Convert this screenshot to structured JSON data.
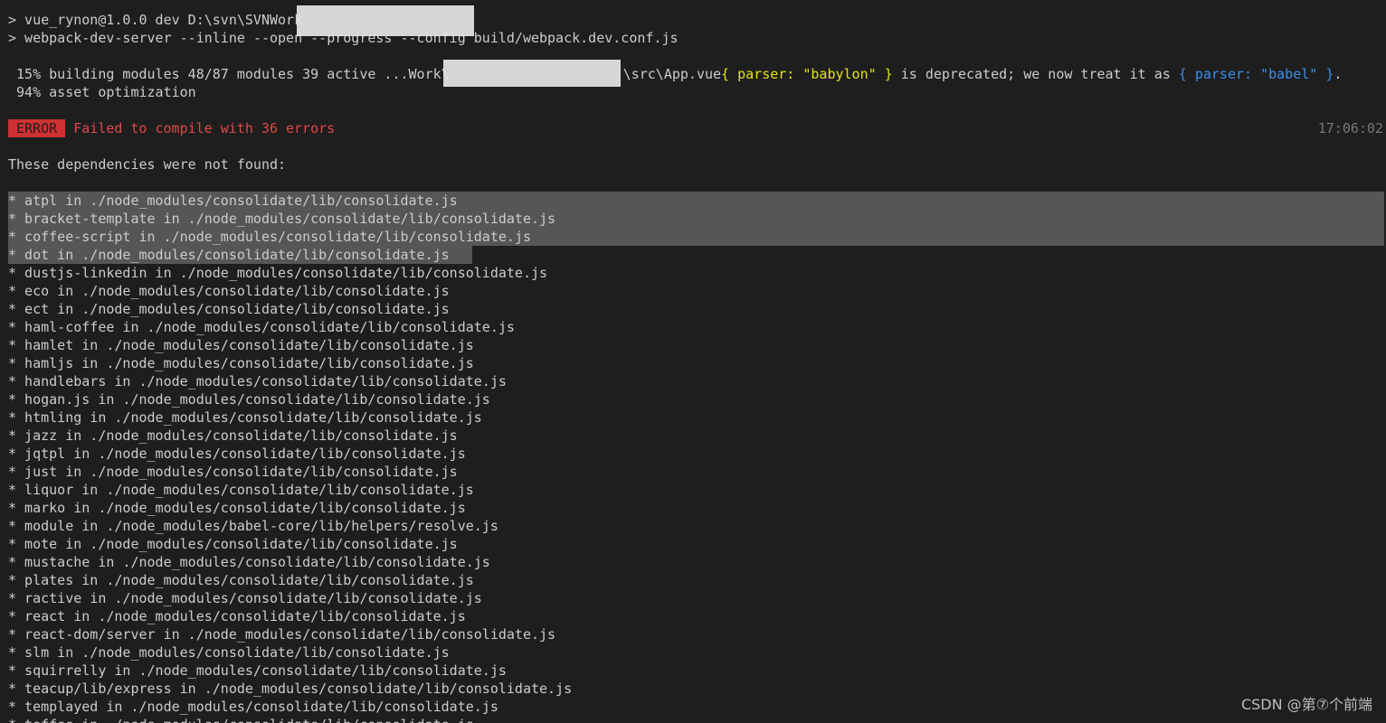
{
  "header": {
    "line1": "> vue_rynon@1.0.0 dev D:\\svn\\SVNWork",
    "line2": "> webpack-dev-server --inline --open --progress --config build/webpack.dev.conf.js"
  },
  "progress": {
    "line_prefix": " 15% building modules 48/87 modules 39 active ...Work\\",
    "path_tail": "\\src\\App.vue",
    "warn_old": "{ parser: \"babylon\" }",
    "warn_mid": " is deprecated; we now treat it as ",
    "warn_new": "{ parser: \"babel\" }",
    "warn_end": ".",
    "asset_line": " 94% asset optimization"
  },
  "error": {
    "badge": "ERROR",
    "message": "Failed to compile with 36 errors",
    "time": "17:06:02"
  },
  "deps_heading": "These dependencies were not found:",
  "deps": [
    "* atpl in ./node_modules/consolidate/lib/consolidate.js",
    "* bracket-template in ./node_modules/consolidate/lib/consolidate.js",
    "* coffee-script in ./node_modules/consolidate/lib/consolidate.js",
    "* dot in ./node_modules/consolidate/lib/consolidate.js",
    "* dustjs-linkedin in ./node_modules/consolidate/lib/consolidate.js",
    "* eco in ./node_modules/consolidate/lib/consolidate.js",
    "* ect in ./node_modules/consolidate/lib/consolidate.js",
    "* haml-coffee in ./node_modules/consolidate/lib/consolidate.js",
    "* hamlet in ./node_modules/consolidate/lib/consolidate.js",
    "* hamljs in ./node_modules/consolidate/lib/consolidate.js",
    "* handlebars in ./node_modules/consolidate/lib/consolidate.js",
    "* hogan.js in ./node_modules/consolidate/lib/consolidate.js",
    "* htmling in ./node_modules/consolidate/lib/consolidate.js",
    "* jazz in ./node_modules/consolidate/lib/consolidate.js",
    "* jqtpl in ./node_modules/consolidate/lib/consolidate.js",
    "* just in ./node_modules/consolidate/lib/consolidate.js",
    "* liquor in ./node_modules/consolidate/lib/consolidate.js",
    "* marko in ./node_modules/consolidate/lib/consolidate.js",
    "* module in ./node_modules/babel-core/lib/helpers/resolve.js",
    "* mote in ./node_modules/consolidate/lib/consolidate.js",
    "* mustache in ./node_modules/consolidate/lib/consolidate.js",
    "* plates in ./node_modules/consolidate/lib/consolidate.js",
    "* ractive in ./node_modules/consolidate/lib/consolidate.js",
    "* react in ./node_modules/consolidate/lib/consolidate.js",
    "* react-dom/server in ./node_modules/consolidate/lib/consolidate.js",
    "* slm in ./node_modules/consolidate/lib/consolidate.js",
    "* squirrelly in ./node_modules/consolidate/lib/consolidate.js",
    "* teacup/lib/express in ./node_modules/consolidate/lib/consolidate.js",
    "* templayed in ./node_modules/consolidate/lib/consolidate.js",
    "* toffee in ./node_modules/consolidate/lib/consolidate.js"
  ],
  "watermark": "CSDN @第⑦个前端",
  "colors": {
    "background": "#1e1e1e",
    "text": "#cccccc",
    "error_badge": "#cd3131",
    "error_text": "#e04848",
    "warn_yellow": "#e5e510",
    "warn_blue": "#3b8eea",
    "selection": "#565656"
  }
}
